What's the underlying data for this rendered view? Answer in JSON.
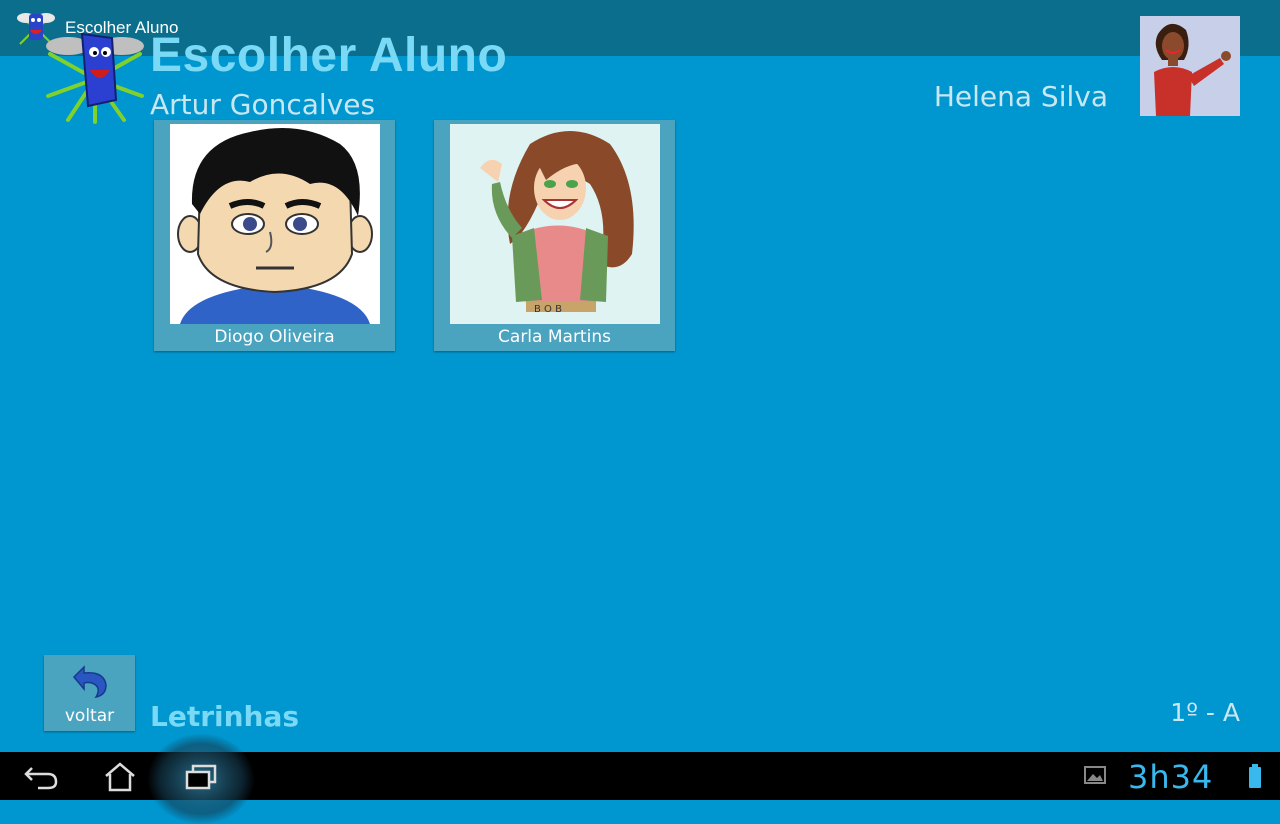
{
  "actionbar": {
    "title": "Escolher Aluno"
  },
  "header": {
    "title": "Escolher Aluno",
    "teacher": "Artur Goncalves",
    "user_name": "Helena Silva"
  },
  "students": [
    {
      "name": "Diogo Oliveira"
    },
    {
      "name": "Carla Martins"
    }
  ],
  "footer": {
    "back_label": "voltar",
    "app_name": "Letrinhas",
    "class": "1º - A"
  },
  "system": {
    "clock": "3h34"
  },
  "colors": {
    "background": "#0096cf",
    "actionbar": "#0b6e8c",
    "accent_text": "#7ad9f5",
    "card": "#4aa3bf"
  },
  "icons": [
    "app-logo-icon",
    "undo-arrow-icon",
    "back-icon",
    "home-icon",
    "recent-apps-icon",
    "gallery-icon",
    "battery-icon"
  ]
}
